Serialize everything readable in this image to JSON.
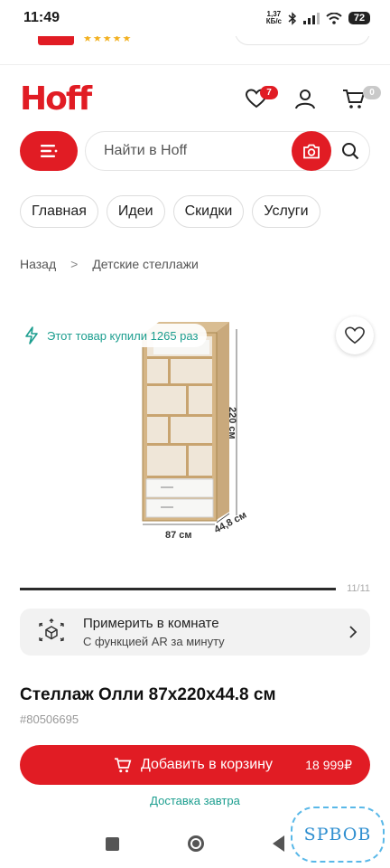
{
  "status_bar": {
    "time": "11:49",
    "net_speed_value": "1,37",
    "net_speed_unit": "КБ/с",
    "battery": "72"
  },
  "header": {
    "logo": "Hoff",
    "favorites_count": "7",
    "cart_count": "0"
  },
  "search": {
    "placeholder": "Найти в Hoff"
  },
  "nav_chips": [
    {
      "label": "Главная"
    },
    {
      "label": "Идеи"
    },
    {
      "label": "Скидки"
    },
    {
      "label": "Услуги"
    }
  ],
  "breadcrumbs": {
    "back": "Назад",
    "separator": ">",
    "current": "Детские стеллажи"
  },
  "gallery": {
    "bought_text": "Этот товар купили 1265 раз",
    "dim_height": "220 см",
    "dim_width": "87 см",
    "dim_depth": "44,8 см",
    "counter": "11/11",
    "progress_fraction": 1.0
  },
  "ar": {
    "title": "Примерить в комнате",
    "subtitle": "С  функцией AR за минуту"
  },
  "product": {
    "title": "Стеллаж Олли 87x220x44.8 см",
    "sku": "#80506695",
    "add_to_cart_label": "Добавить в корзину",
    "price": "18 999₽",
    "delivery": "Доставка завтра"
  },
  "watermark": "SPBOB",
  "colors": {
    "brand": "#e11c24",
    "accent_teal": "#1c9e8f",
    "text": "#1a1a1a"
  }
}
